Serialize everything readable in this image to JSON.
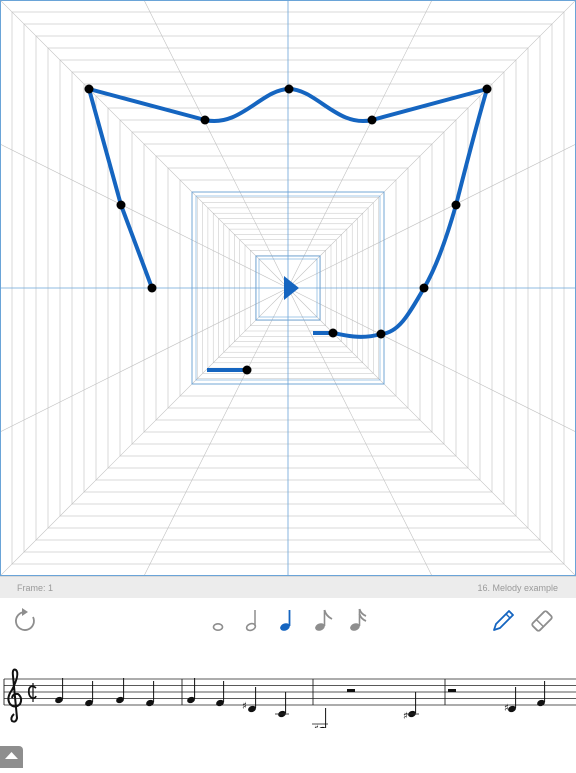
{
  "status": {
    "frame_label": "Frame: 1",
    "preset_label": "16. Melody example"
  },
  "toolbar": {
    "left_tool": "loop-icon",
    "note_durations": [
      "whole-note-icon",
      "half-note-icon",
      "quarter-note-icon",
      "eighth-note-icon",
      "sixteenth-note-icon"
    ],
    "selected_duration": "quarter-note-icon",
    "right_tools": [
      "pencil-icon",
      "eraser-icon"
    ],
    "selected_right_tool": "pencil-icon"
  },
  "colors": {
    "accent": "#1565c0",
    "grid_line": "#c2c2c2",
    "guide_line": "#6aa4d8",
    "point": "#000000",
    "status_bg": "#ececec",
    "icon_gray": "#8e8e8e"
  },
  "score": {
    "clef": "treble",
    "time_signature": "cut time",
    "measures": 4
  },
  "bottom_toggle_icon": "chevron-up-icon"
}
